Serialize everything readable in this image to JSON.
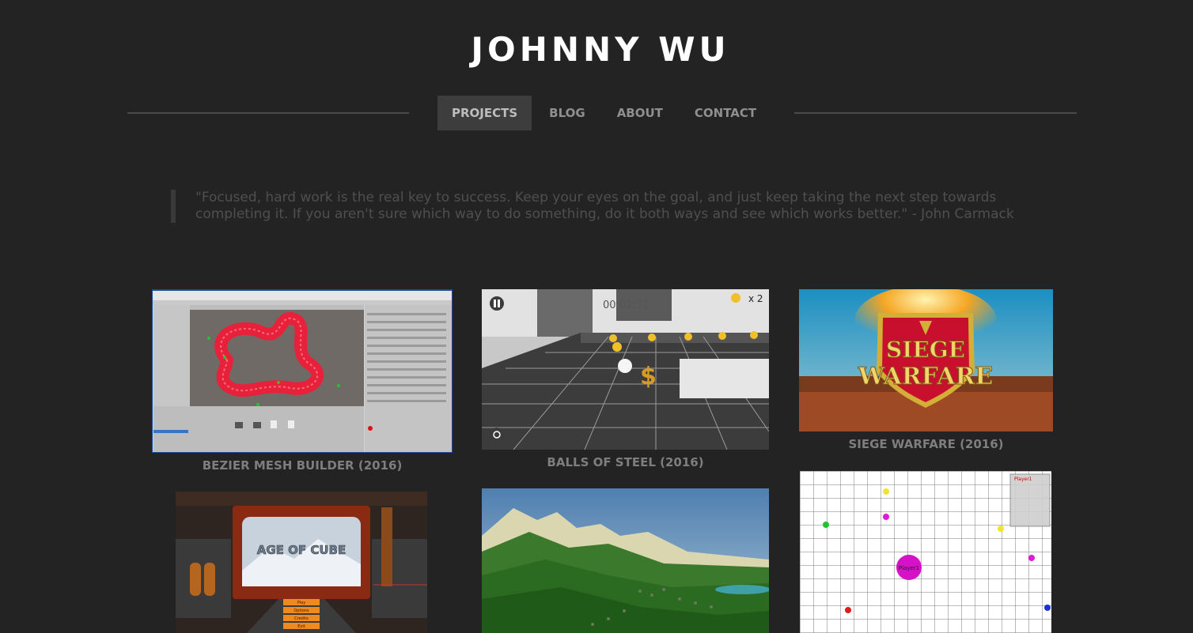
{
  "site": {
    "title": "JOHNNY WU"
  },
  "nav": {
    "items": [
      {
        "label": "PROJECTS",
        "active": true
      },
      {
        "label": "BLOG",
        "active": false
      },
      {
        "label": "ABOUT",
        "active": false
      },
      {
        "label": "CONTACT",
        "active": false
      }
    ]
  },
  "quote": {
    "text": "\"Focused, hard work is the real key to success. Keep your eyes on the goal, and just keep taking the next step towards completing it. If you aren't sure which way to do something, do it both ways and see which works better.\" - John Carmack"
  },
  "projects": [
    {
      "title": "BEZIER MESH BUILDER (2016)",
      "image": "unity-editor-bezier-tube-screenshot"
    },
    {
      "title": "BALLS OF STEEL (2016)",
      "image": "ball-rolling-game-screenshot",
      "hud": {
        "timer": "00:02:71",
        "coins": "x 2"
      }
    },
    {
      "title": "SIEGE WARFARE (2016)",
      "image": "siege-warfare-shield-logo",
      "logo_text": [
        "SIEGE",
        "WARFARE"
      ]
    },
    {
      "title": "",
      "image": "age-of-cube-menu-screenshot",
      "logo_text": "AGE OF CUBE",
      "menu_buttons": [
        "Play",
        "Options",
        "Credits",
        "Exit"
      ]
    },
    {
      "title": "",
      "image": "low-poly-mountain-terrain-screenshot"
    },
    {
      "title": "",
      "image": "agar-style-grid-game-screenshot",
      "player_label": "Player1",
      "minimap_label": "Player1"
    }
  ],
  "colors": {
    "background": "#232323",
    "title": "#ffffff",
    "nav_text": "#8f8f8f",
    "nav_active_bg": "#3d3d3d",
    "caption": "#7e7e7e",
    "quote_text": "#4f4f4f"
  }
}
